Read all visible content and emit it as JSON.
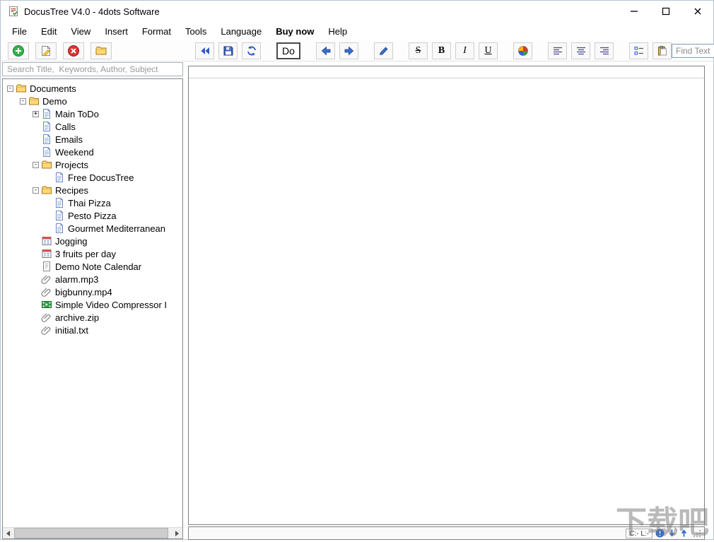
{
  "window": {
    "title": "DocusTree V4.0 - 4dots Software",
    "app_icon": "app-icon",
    "controls": [
      {
        "name": "minimize-button",
        "icon": "minimize-icon"
      },
      {
        "name": "maximize-button",
        "icon": "maximize-icon"
      },
      {
        "name": "close-button",
        "icon": "close-icon"
      }
    ]
  },
  "menu": {
    "items": [
      {
        "label": "File"
      },
      {
        "label": "Edit"
      },
      {
        "label": "View"
      },
      {
        "label": "Insert"
      },
      {
        "label": "Format"
      },
      {
        "label": "Tools"
      },
      {
        "label": "Language"
      },
      {
        "label": "Buy now",
        "bold": true
      },
      {
        "label": "Help"
      }
    ]
  },
  "toolbar": {
    "left_buttons": [
      {
        "name": "add-item-button",
        "icon": "plus-circle-icon"
      },
      {
        "name": "edit-item-button",
        "icon": "note-edit-icon"
      },
      {
        "name": "delete-item-button",
        "icon": "red-x-circle-icon"
      },
      {
        "name": "copy-item-button",
        "icon": "folder-yellow-icon"
      }
    ],
    "main_buttons": [
      {
        "name": "collapse-all-button",
        "icon": "double-arrow-left-icon"
      },
      {
        "name": "save-button",
        "icon": "save-icon"
      },
      {
        "name": "refresh-button",
        "icon": "refresh-icon"
      },
      {
        "spacer": true
      },
      {
        "name": "do-button",
        "label": "Do"
      },
      {
        "spacer": true
      },
      {
        "name": "back-button",
        "icon": "arrow-left-icon"
      },
      {
        "name": "forward-button",
        "icon": "arrow-right-icon"
      },
      {
        "spacer": true
      },
      {
        "name": "edit-pen-button",
        "icon": "pen-icon"
      },
      {
        "spacer": true
      },
      {
        "name": "strikethrough-button",
        "glyph": "S",
        "style": "strike"
      },
      {
        "name": "bold-button",
        "glyph": "B",
        "style": "bold"
      },
      {
        "name": "italic-button",
        "glyph": "I",
        "style": "italic"
      },
      {
        "name": "underline-button",
        "glyph": "U",
        "style": "underline"
      },
      {
        "spacer": true
      },
      {
        "name": "font-color-button",
        "icon": "palette-icon"
      },
      {
        "spacer": true
      },
      {
        "name": "align-left-button",
        "icon": "align-left-icon"
      },
      {
        "name": "align-center-button",
        "icon": "align-center-icon"
      },
      {
        "name": "align-right-button",
        "icon": "align-right-icon"
      },
      {
        "spacer": true
      },
      {
        "name": "checklist-button",
        "icon": "checklist-icon"
      },
      {
        "name": "paste-button",
        "icon": "clipboard-icon"
      }
    ],
    "find_input": {
      "placeholder": "Find Text"
    }
  },
  "sidebar": {
    "search_placeholder": "Search Title,  Keywords, Author, Subject",
    "tree": [
      {
        "label": "Documents",
        "icon": "folder-icon",
        "level": 0,
        "expander": "minus"
      },
      {
        "label": "Demo",
        "icon": "folder-icon",
        "level": 1,
        "expander": "minus"
      },
      {
        "label": "Main ToDo",
        "icon": "document-icon",
        "level": 2,
        "expander": "plus"
      },
      {
        "label": "Calls",
        "icon": "document-icon",
        "level": 2,
        "expander": "none"
      },
      {
        "label": "Emails",
        "icon": "document-icon",
        "level": 2,
        "expander": "none"
      },
      {
        "label": "Weekend",
        "icon": "document-icon",
        "level": 2,
        "expander": "none"
      },
      {
        "label": "Projects",
        "icon": "folder-icon",
        "level": 2,
        "expander": "minus"
      },
      {
        "label": "Free DocusTree",
        "icon": "document-icon",
        "level": 3,
        "expander": "none"
      },
      {
        "label": "Recipes",
        "icon": "folder-icon",
        "level": 2,
        "expander": "minus"
      },
      {
        "label": "Thai Pizza",
        "icon": "document-icon",
        "level": 3,
        "expander": "none"
      },
      {
        "label": "Pesto Pizza",
        "icon": "document-icon",
        "level": 3,
        "expander": "none"
      },
      {
        "label": "Gourmet Mediterranean",
        "icon": "document-icon",
        "level": 3,
        "expander": "none"
      },
      {
        "label": "Jogging",
        "icon": "task-icon",
        "level": 2,
        "expander": "none"
      },
      {
        "label": "3 fruits per day",
        "icon": "task-icon",
        "level": 2,
        "expander": "none"
      },
      {
        "label": "Demo Note Calendar",
        "icon": "note-icon",
        "level": 2,
        "expander": "none"
      },
      {
        "label": "alarm.mp3",
        "icon": "attachment-icon",
        "level": 2,
        "expander": "none"
      },
      {
        "label": "bigbunny.mp4",
        "icon": "attachment-icon",
        "level": 2,
        "expander": "none"
      },
      {
        "label": "Simple Video Compressor I",
        "icon": "video-icon",
        "level": 2,
        "expander": "none"
      },
      {
        "label": "archive.zip",
        "icon": "attachment-icon",
        "level": 2,
        "expander": "none"
      },
      {
        "label": "initial.txt",
        "icon": "attachment-icon",
        "level": 2,
        "expander": "none"
      }
    ]
  },
  "statusbar": {
    "position_label": "C:- L:-",
    "icons": [
      "info-circle-icon",
      "scroll-down-icon",
      "scroll-up-icon"
    ]
  },
  "watermark": {
    "text": "下载吧"
  }
}
